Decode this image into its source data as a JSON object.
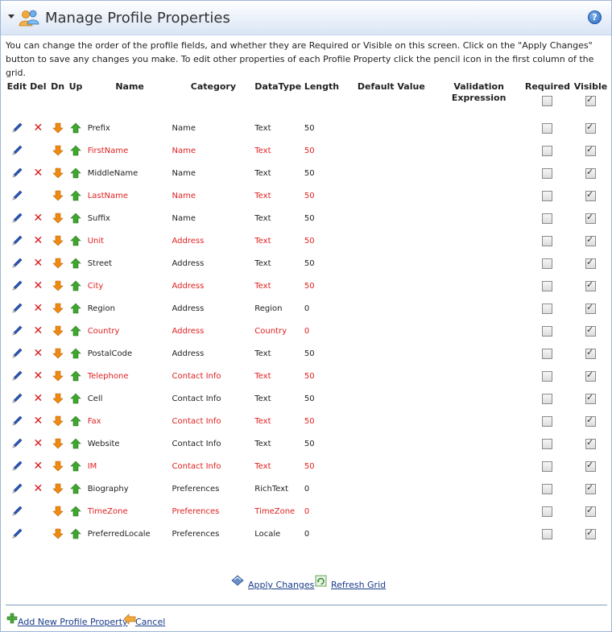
{
  "header": {
    "title": "Manage Profile Properties",
    "help_symbol": "?"
  },
  "intro": "You can change the order of the profile fields, and whether they are Required or Visible on this screen. Click on the \"Apply Changes\" button to save any changes you make. To edit other properties of each Profile Property click the pencil icon in the first column of the grid.",
  "columns": {
    "edit": "Edit",
    "del": "Del",
    "dn": "Dn",
    "up": "Up",
    "name": "Name",
    "category": "Category",
    "datatype": "DataType",
    "length": "Length",
    "default_value": "Default Value",
    "validation": "Validation Expression",
    "required": "Required",
    "visible": "Visible"
  },
  "header_required_checked": false,
  "header_visible_checked": true,
  "rows": [
    {
      "name": "Prefix",
      "category": "Name",
      "datatype": "Text",
      "length": "50",
      "required_field": false,
      "can_delete": true,
      "required": false,
      "visible": true
    },
    {
      "name": "FirstName",
      "category": "Name",
      "datatype": "Text",
      "length": "50",
      "required_field": true,
      "can_delete": false,
      "required": false,
      "visible": true
    },
    {
      "name": "MiddleName",
      "category": "Name",
      "datatype": "Text",
      "length": "50",
      "required_field": false,
      "can_delete": true,
      "required": false,
      "visible": true
    },
    {
      "name": "LastName",
      "category": "Name",
      "datatype": "Text",
      "length": "50",
      "required_field": true,
      "can_delete": false,
      "required": false,
      "visible": true
    },
    {
      "name": "Suffix",
      "category": "Name",
      "datatype": "Text",
      "length": "50",
      "required_field": false,
      "can_delete": true,
      "required": false,
      "visible": true
    },
    {
      "name": "Unit",
      "category": "Address",
      "datatype": "Text",
      "length": "50",
      "required_field": true,
      "can_delete": true,
      "required": false,
      "visible": true
    },
    {
      "name": "Street",
      "category": "Address",
      "datatype": "Text",
      "length": "50",
      "required_field": false,
      "can_delete": true,
      "required": false,
      "visible": true
    },
    {
      "name": "City",
      "category": "Address",
      "datatype": "Text",
      "length": "50",
      "required_field": true,
      "can_delete": true,
      "required": false,
      "visible": true
    },
    {
      "name": "Region",
      "category": "Address",
      "datatype": "Region",
      "length": "0",
      "required_field": false,
      "can_delete": true,
      "required": false,
      "visible": true
    },
    {
      "name": "Country",
      "category": "Address",
      "datatype": "Country",
      "length": "0",
      "required_field": true,
      "can_delete": true,
      "required": false,
      "visible": true
    },
    {
      "name": "PostalCode",
      "category": "Address",
      "datatype": "Text",
      "length": "50",
      "required_field": false,
      "can_delete": true,
      "required": false,
      "visible": true
    },
    {
      "name": "Telephone",
      "category": "Contact Info",
      "datatype": "Text",
      "length": "50",
      "required_field": true,
      "can_delete": true,
      "required": false,
      "visible": true
    },
    {
      "name": "Cell",
      "category": "Contact Info",
      "datatype": "Text",
      "length": "50",
      "required_field": false,
      "can_delete": true,
      "required": false,
      "visible": true
    },
    {
      "name": "Fax",
      "category": "Contact Info",
      "datatype": "Text",
      "length": "50",
      "required_field": true,
      "can_delete": true,
      "required": false,
      "visible": true
    },
    {
      "name": "Website",
      "category": "Contact Info",
      "datatype": "Text",
      "length": "50",
      "required_field": false,
      "can_delete": true,
      "required": false,
      "visible": true
    },
    {
      "name": "IM",
      "category": "Contact Info",
      "datatype": "Text",
      "length": "50",
      "required_field": true,
      "can_delete": true,
      "required": false,
      "visible": true
    },
    {
      "name": "Biography",
      "category": "Preferences",
      "datatype": "RichText",
      "length": "0",
      "required_field": false,
      "can_delete": true,
      "required": false,
      "visible": true
    },
    {
      "name": "TimeZone",
      "category": "Preferences",
      "datatype": "TimeZone",
      "length": "0",
      "required_field": true,
      "can_delete": false,
      "required": false,
      "visible": true
    },
    {
      "name": "PreferredLocale",
      "category": "Preferences",
      "datatype": "Locale",
      "length": "0",
      "required_field": false,
      "can_delete": false,
      "required": false,
      "visible": true
    }
  ],
  "actions": {
    "apply_changes": "Apply Changes",
    "refresh_grid": "Refresh Grid"
  },
  "footer": {
    "add_new": "Add New Profile Property",
    "cancel": "Cancel"
  },
  "colors": {
    "required_text": "#e02020",
    "link": "#1a3c8a",
    "delete": "#d81818",
    "edit_pencil": "#2a57b8",
    "down_arrow": "#f08a10",
    "up_arrow": "#3a9a2a"
  }
}
